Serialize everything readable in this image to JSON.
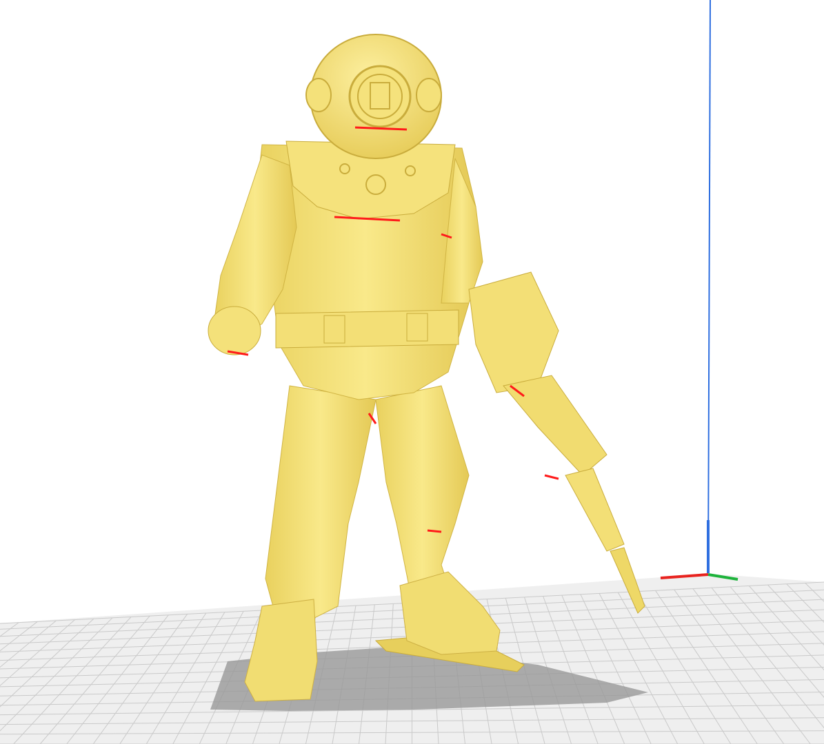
{
  "viewport": {
    "description_free": true,
    "scene_objects": [
      {
        "name": "model",
        "icon": "diver-figurine-model",
        "color": "#f6e37a",
        "overhang_color": "#ff1a1a"
      }
    ],
    "build_plate": {
      "grid_color": "#c9c9c9",
      "plate_color": "#eeeeee",
      "shadow_color": "#9a9a9a"
    },
    "axes": {
      "x_color": "#e8231f",
      "y_color": "#1db33b",
      "z_color": "#2f6fe0"
    },
    "volume_edge_color": "#2f6fe0"
  }
}
